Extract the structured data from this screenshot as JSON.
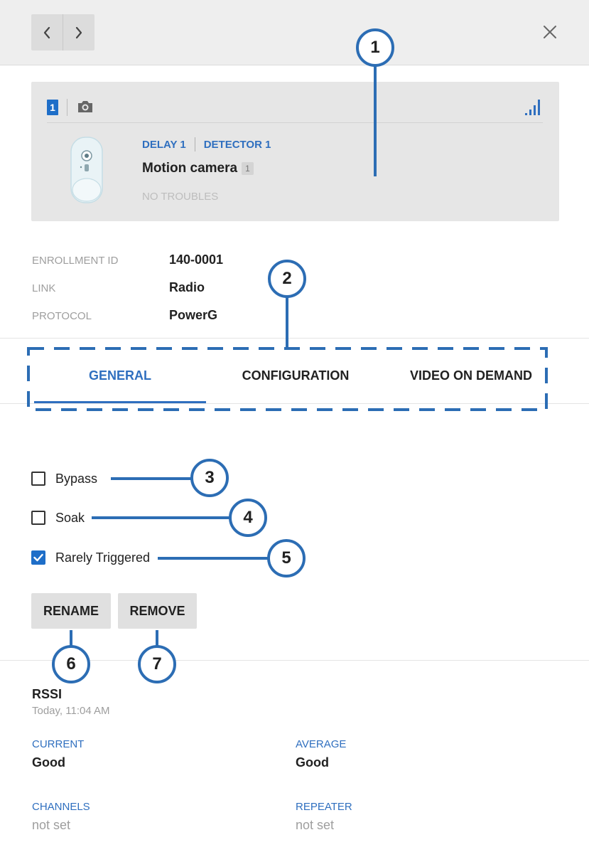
{
  "colors": {
    "accent": "#2f6fbf",
    "annotation": "#2c6db4",
    "badge": "#1e6ec8"
  },
  "toolbar": {
    "prev_icon": "chevron-left-icon",
    "next_icon": "chevron-right-icon",
    "close_icon": "close-icon"
  },
  "device": {
    "number": "1",
    "type_icon": "camera-icon",
    "signal_icon": "signal-bars-icon",
    "partition": "DELAY 1",
    "detector": "DETECTOR 1",
    "name": "Motion camera",
    "name_badge": "1",
    "status": "NO TROUBLES"
  },
  "info": [
    {
      "label": "ENROLLMENT ID",
      "value": "140-0001"
    },
    {
      "label": "LINK",
      "value": "Radio"
    },
    {
      "label": "PROTOCOL",
      "value": "PowerG"
    }
  ],
  "tabs": [
    {
      "label": "GENERAL",
      "active": true
    },
    {
      "label": "CONFIGURATION",
      "active": false
    },
    {
      "label": "VIDEO ON DEMAND",
      "active": false
    }
  ],
  "options": [
    {
      "label": "Bypass",
      "checked": false
    },
    {
      "label": "Soak",
      "checked": false
    },
    {
      "label": "Rarely Triggered",
      "checked": true
    }
  ],
  "actions": {
    "rename": "RENAME",
    "remove": "REMOVE"
  },
  "rssi": {
    "title": "RSSI",
    "time": "Today, 11:04 AM",
    "current_label": "CURRENT",
    "current_value": "Good",
    "average_label": "AVERAGE",
    "average_value": "Good",
    "channels_label": "CHANNELS",
    "channels_value": "not set",
    "repeater_label": "REPEATER",
    "repeater_value": "not set"
  },
  "annotations": [
    "1",
    "2",
    "3",
    "4",
    "5",
    "6",
    "7"
  ]
}
